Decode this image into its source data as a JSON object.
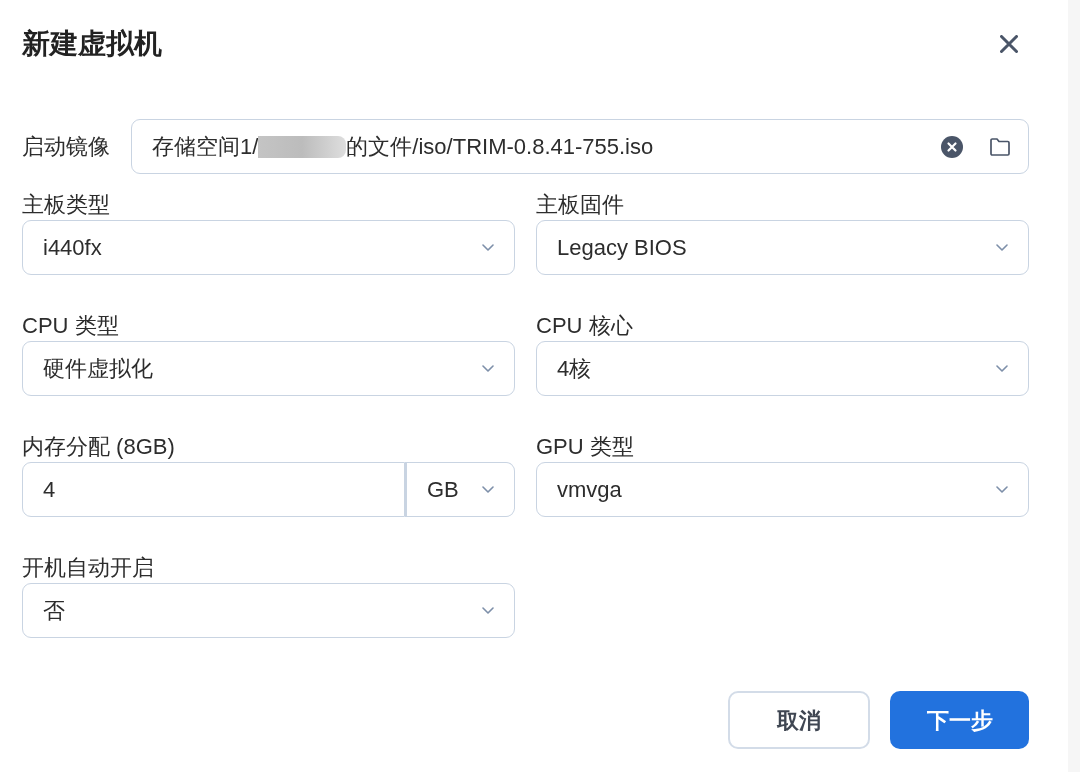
{
  "dialog": {
    "title": "新建虚拟机"
  },
  "boot_image": {
    "label": "启动镜像",
    "value_before": "存储空间1/",
    "redacted": true,
    "value_after": "的文件/iso/TRIM-0.8.41-755.iso"
  },
  "fields": [
    {
      "kind": "select",
      "label": "主板类型",
      "value": "i440fx"
    },
    {
      "kind": "select",
      "label": "主板固件",
      "value": "Legacy BIOS"
    },
    {
      "kind": "select",
      "label": "CPU 类型",
      "value": "硬件虚拟化"
    },
    {
      "kind": "select",
      "label": "CPU 核心",
      "value": "4核"
    },
    {
      "kind": "input_with_unit",
      "label": "内存分配 (8GB)",
      "value": "4",
      "unit": "GB"
    },
    {
      "kind": "select",
      "label": "GPU 类型",
      "value": "vmvga"
    },
    {
      "kind": "select",
      "label": "开机自动开启",
      "value": "否"
    }
  ],
  "buttons": [
    {
      "kind": "secondary",
      "label": "取消"
    },
    {
      "kind": "primary",
      "label": "下一步"
    }
  ]
}
